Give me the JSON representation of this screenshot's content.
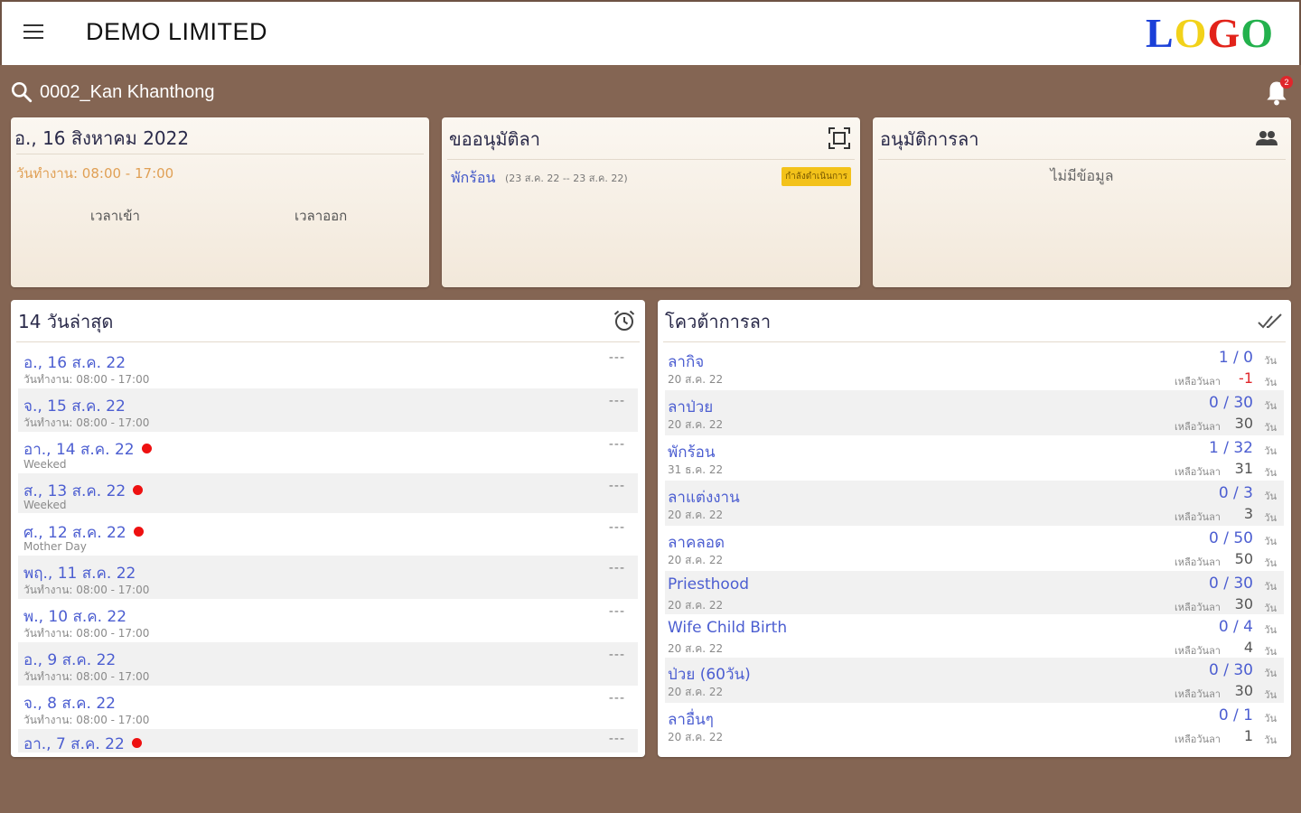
{
  "header": {
    "company": "DEMO LIMITED",
    "logo": [
      "L",
      "O",
      "G",
      "O"
    ]
  },
  "search": {
    "value": "0002_Kan Khanthong",
    "notification_count": "2"
  },
  "today_card": {
    "date": "อ., 16 สิงหาคม 2022",
    "shift": "วันทำงาน: 08:00 - 17:00",
    "time_in_label": "เวลาเข้า",
    "time_out_label": "เวลาออก"
  },
  "leave_request_card": {
    "title": "ขออนุมัติลา",
    "item_type": "พักร้อน",
    "item_range": "(23 ส.ค. 22 -- 23 ส.ค. 22)",
    "item_status": "กำลังดำเนินการ"
  },
  "approve_card": {
    "title": "อนุมัติการลา",
    "empty": "ไม่มีข้อมูล"
  },
  "recent_card": {
    "title": "14 วันล่าสุด",
    "items": [
      {
        "date": "อ., 16 ส.ค. 22",
        "sub": "วันทำงาน: 08:00 - 17:00",
        "dash": "---"
      },
      {
        "date": "จ., 15 ส.ค. 22",
        "sub": "วันทำงาน: 08:00 - 17:00",
        "dash": "---"
      },
      {
        "date": "อา., 14 ส.ค. 22",
        "sub": "Weeked",
        "dash": "---"
      },
      {
        "date": "ส., 13 ส.ค. 22",
        "sub": "Weeked",
        "dash": "---"
      },
      {
        "date": "ศ., 12 ส.ค. 22",
        "sub": "Mother Day",
        "dash": "---"
      },
      {
        "date": "พฤ., 11 ส.ค. 22",
        "sub": "วันทำงาน: 08:00 - 17:00",
        "dash": "---"
      },
      {
        "date": "พ., 10 ส.ค. 22",
        "sub": "วันทำงาน: 08:00 - 17:00",
        "dash": "---"
      },
      {
        "date": "อ., 9 ส.ค. 22",
        "sub": "วันทำงาน: 08:00 - 17:00",
        "dash": "---"
      },
      {
        "date": "จ., 8 ส.ค. 22",
        "sub": "วันทำงาน: 08:00 - 17:00",
        "dash": "---"
      },
      {
        "date": "อา., 7 ส.ค. 22",
        "sub": "",
        "dash": "---"
      }
    ]
  },
  "quota_card": {
    "title": "โควต้าการลา",
    "remain_label": "เหลือวันลา",
    "unit": "วัน",
    "items": [
      {
        "name": "ลากิจ",
        "date": "20 ส.ค. 22",
        "ratio": "1 / 0",
        "remain": "-1"
      },
      {
        "name": "ลาป่วย",
        "date": "20 ส.ค. 22",
        "ratio": "0 / 30",
        "remain": "30"
      },
      {
        "name": "พักร้อน",
        "date": "31 ธ.ค. 22",
        "ratio": "1 / 32",
        "remain": "31"
      },
      {
        "name": "ลาแต่งงาน",
        "date": "20 ส.ค. 22",
        "ratio": "0 / 3",
        "remain": "3"
      },
      {
        "name": "ลาคลอด",
        "date": "20 ส.ค. 22",
        "ratio": "0 / 50",
        "remain": "50"
      },
      {
        "name": "Priesthood",
        "date": "20 ส.ค. 22",
        "ratio": "0 / 30",
        "remain": "30"
      },
      {
        "name": "Wife Child Birth",
        "date": "20 ส.ค. 22",
        "ratio": "0 / 4",
        "remain": "4"
      },
      {
        "name": "ป่วย (60วัน)",
        "date": "20 ส.ค. 22",
        "ratio": "0 / 30",
        "remain": "30"
      },
      {
        "name": "ลาอื่นๆ",
        "date": "20 ส.ค. 22",
        "ratio": "0 / 1",
        "remain": "1"
      }
    ]
  }
}
